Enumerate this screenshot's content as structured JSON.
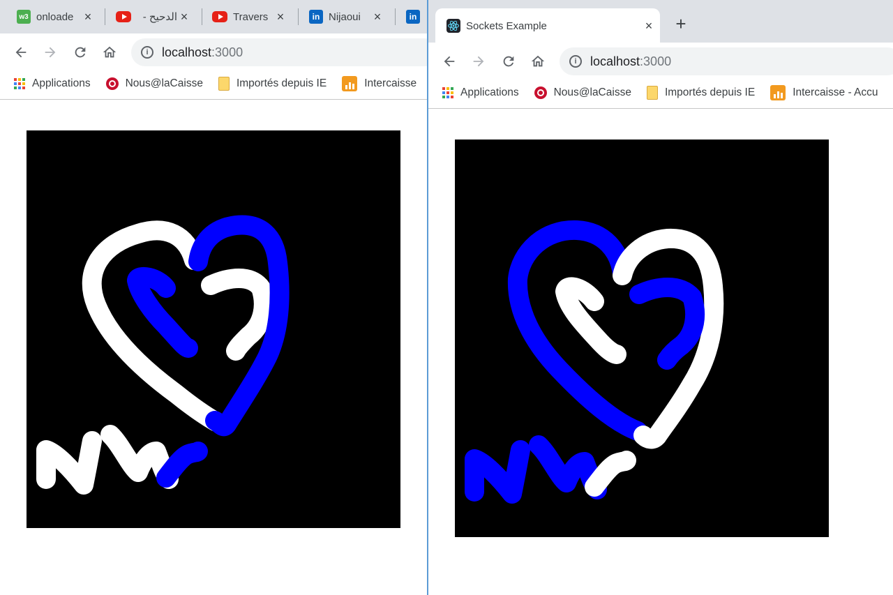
{
  "left_window": {
    "tabs": [
      {
        "title": "onloade",
        "icon": "w3schools-icon"
      },
      {
        "title": "الدحيح -",
        "icon": "youtube-icon"
      },
      {
        "title": "Traversy",
        "icon": "youtube-icon"
      },
      {
        "title": "Nijaoui",
        "icon": "linkedin-icon"
      },
      {
        "title": "",
        "icon": "linkedin-icon"
      }
    ],
    "url_host": "localhost",
    "url_port": ":3000",
    "bookmarks": [
      "Applications",
      "Nous@laCaisse",
      "Importés depuis IE",
      "Intercaisse"
    ]
  },
  "right_window": {
    "tab_title": "Sockets Example",
    "url_host": "localhost",
    "url_port": ":3000",
    "bookmarks": [
      "Applications",
      "Nous@laCaisse",
      "Importés depuis IE",
      "Intercaisse - Accu"
    ]
  },
  "icons": {
    "close": "×",
    "new_tab": "+",
    "info": "i"
  },
  "colors": {
    "canvas_bg": "#000000",
    "stroke_white": "#ffffff",
    "stroke_blue": "#0000ff",
    "tab_strip": "#dee1e6",
    "window_border": "#5b9bd5"
  }
}
